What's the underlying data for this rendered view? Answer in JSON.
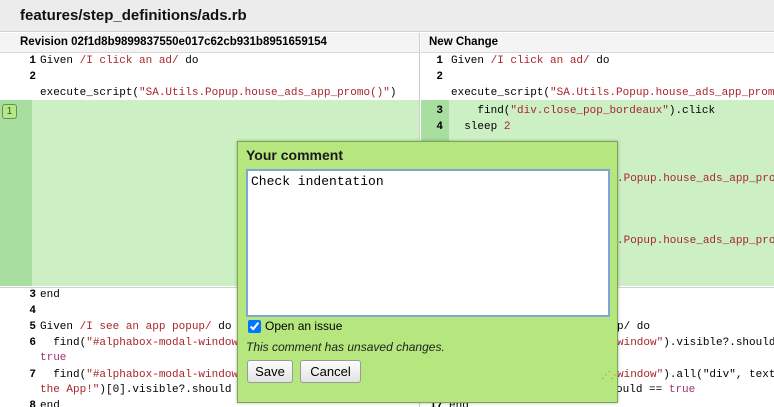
{
  "file": {
    "path": "features/step_definitions/ads.rb"
  },
  "headers": {
    "left": "Revision 02f1d8b9899837550e017c62cb931b8951659154",
    "right": "New Change"
  },
  "left_lines": [
    {
      "n": "1",
      "tokens": [
        [
          "kw",
          "Given "
        ],
        [
          "re",
          "/I click an ad/"
        ],
        [
          "kw",
          " do"
        ]
      ]
    },
    {
      "n": "2",
      "tokens": []
    },
    {
      "n": "",
      "tokens": [
        [
          "kw",
          "execute_script("
        ],
        [
          "str",
          "\"SA.Utils.Popup.house_ads_app_promo()\""
        ],
        [
          "kw",
          ")"
        ]
      ]
    },
    {
      "n": "3",
      "tokens": [
        [
          "kw",
          "end"
        ]
      ]
    },
    {
      "n": "4",
      "tokens": []
    },
    {
      "n": "5",
      "tokens": [
        [
          "kw",
          "Given "
        ],
        [
          "re",
          "/I see an app popup/"
        ],
        [
          "kw",
          " do"
        ]
      ]
    },
    {
      "n": "6",
      "tokens": [
        [
          "kw",
          "  find("
        ],
        [
          "str",
          "\"#alphabox-modal-window\""
        ],
        [
          "kw",
          ").visible?.should == "
        ]
      ]
    },
    {
      "n": "",
      "tokens": [
        [
          "bool",
          "true"
        ]
      ]
    },
    {
      "n": "7",
      "tokens": [
        [
          "kw",
          "  find("
        ],
        [
          "str",
          "\"#alphabox-modal-window\""
        ],
        [
          "kw",
          ").all(\"div\", text: \""
        ]
      ]
    },
    {
      "n": "",
      "tokens": [
        [
          "str",
          "the App!\""
        ],
        [
          "kw",
          ")[0].visible?.should == "
        ],
        [
          "bool",
          "true"
        ]
      ]
    },
    {
      "n": "8",
      "tokens": [
        [
          "kw",
          "end"
        ]
      ]
    }
  ],
  "right_lines": [
    {
      "n": "1",
      "tokens": [
        [
          "kw",
          "Given "
        ],
        [
          "re",
          "/I click an ad/"
        ],
        [
          "kw",
          " do"
        ]
      ]
    },
    {
      "n": "2",
      "tokens": []
    },
    {
      "n": "",
      "tokens": [
        [
          "kw",
          "execute_script("
        ],
        [
          "str",
          "\"SA.Utils.Popup.house_ads_app_promo()\""
        ],
        [
          "kw",
          ")"
        ]
      ]
    },
    {
      "n": "3",
      "tokens": [
        [
          "kw",
          "    find("
        ],
        [
          "str",
          "\"div.close_pop_bordeaux\""
        ],
        [
          "kw",
          ").click"
        ]
      ]
    },
    {
      "n": "4",
      "tokens": [
        [
          "kw",
          "  sleep "
        ],
        [
          "num",
          "2"
        ]
      ]
    },
    {
      "n": "",
      "tokens": [
        [
          "str",
          ".Popup.house_ads_app_promo()\""
        ]
      ]
    },
    {
      "n": "",
      "tokens": [
        [
          "str",
          ".Popup.house_ads_app_promo()\""
        ]
      ]
    },
    {
      "n": "",
      "tokens": [
        [
          "kw",
          "p/"
        ],
        [
          "kw",
          " do"
        ]
      ]
    },
    {
      "n": "",
      "tokens": [
        [
          "str",
          "window\""
        ],
        [
          "kw",
          ").visible?.should == "
        ],
        [
          "bool",
          "true"
        ]
      ]
    },
    {
      "n": "",
      "tokens": [
        [
          "str",
          "window\""
        ],
        [
          "kw",
          ").all(\"div\", text: \""
        ]
      ]
    },
    {
      "n": "",
      "tokens": [
        [
          "str",
          "the App!\""
        ],
        [
          "kw",
          ")[0].visible?.should == "
        ],
        [
          "bool",
          "true"
        ]
      ]
    },
    {
      "n": "17",
      "tokens": [
        [
          "kw",
          "end"
        ]
      ]
    }
  ],
  "comment": {
    "marker": "1",
    "title": "Your comment",
    "text": "Check indentation",
    "open_issue_label": "Open an issue",
    "open_issue_checked": true,
    "unsaved_note": "This comment has unsaved changes.",
    "save_label": "Save",
    "cancel_label": "Cancel"
  },
  "colors": {
    "added_background": "#ccf0c4",
    "comment_background": "#b5e77e",
    "string": "#a8262c"
  }
}
